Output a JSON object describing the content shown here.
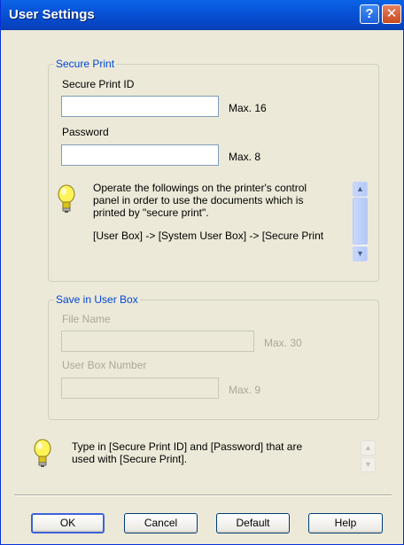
{
  "window": {
    "title": "User Settings",
    "help_glyph": "?",
    "close_glyph": "✕"
  },
  "secure_print": {
    "legend": "Secure Print",
    "id_label": "Secure Print ID",
    "id_value": "",
    "id_max": "Max. 16",
    "password_label": "Password",
    "password_value": "",
    "password_max": "Max. 8",
    "info_line1": "Operate the followings on the printer's control",
    "info_line2": "panel in order to use the documents which is",
    "info_line3": "printed by \"secure print\".",
    "info_line4": "[User Box] -> [System User Box] -> [Secure Print"
  },
  "user_box": {
    "legend": "Save in User Box",
    "file_name_label": "File Name",
    "file_name_value": "",
    "file_name_max": "Max. 30",
    "box_number_label": "User Box Number",
    "box_number_value": "",
    "box_number_max": "Max. 9"
  },
  "hint": {
    "line1": "Type in [Secure Print ID] and [Password] that are",
    "line2": "used with [Secure Print]."
  },
  "buttons": {
    "ok": "OK",
    "cancel": "Cancel",
    "default": "Default",
    "help": "Help"
  },
  "icons": {
    "info": "lightbulb-icon",
    "up": "▲",
    "down": "▼"
  },
  "colors": {
    "titlebar": "#0a5fe3",
    "group_legend": "#0046d5",
    "dialog_bg": "#ece9d8"
  }
}
